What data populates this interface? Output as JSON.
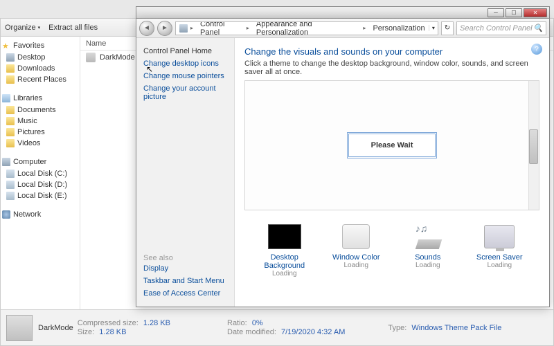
{
  "explorer": {
    "toolbar": {
      "organize": "Organize",
      "extract": "Extract all files"
    },
    "nav": {
      "favorites_header": "Favorites",
      "favorites": [
        "Desktop",
        "Downloads",
        "Recent Places"
      ],
      "libraries_header": "Libraries",
      "libraries": [
        "Documents",
        "Music",
        "Pictures",
        "Videos"
      ],
      "computer_header": "Computer",
      "drives": [
        "Local Disk (C:)",
        "Local Disk (D:)",
        "Local Disk (E:)"
      ],
      "network_header": "Network"
    },
    "columns": {
      "name": "Name"
    },
    "files": [
      {
        "name": "DarkMode"
      }
    ],
    "status": {
      "filename": "DarkMode",
      "compressed_label": "Compressed size:",
      "compressed": "1.28 KB",
      "size_label": "Size:",
      "size": "1.28 KB",
      "ratio_label": "Ratio:",
      "ratio": "0%",
      "modified_label": "Date modified:",
      "modified": "7/19/2020 4:32 AM",
      "type_label": "Type:",
      "type": "Windows Theme Pack File"
    }
  },
  "cp": {
    "breadcrumb": [
      "Control Panel",
      "Appearance and Personalization",
      "Personalization"
    ],
    "search_placeholder": "Search Control Panel",
    "left": {
      "home": "Control Panel Home",
      "links": [
        "Change desktop icons",
        "Change mouse pointers",
        "Change your account picture"
      ],
      "see_also_label": "See also",
      "see_also": [
        "Display",
        "Taskbar and Start Menu",
        "Ease of Access Center"
      ]
    },
    "main": {
      "heading": "Change the visuals and sounds on your computer",
      "subtext": "Click a theme to change the desktop background, window color, sounds, and screen saver all at once.",
      "wait": "Please Wait",
      "tiles": [
        {
          "label": "Desktop Background",
          "status": "Loading"
        },
        {
          "label": "Window Color",
          "status": "Loading"
        },
        {
          "label": "Sounds",
          "status": "Loading"
        },
        {
          "label": "Screen Saver",
          "status": "Loading"
        }
      ]
    }
  }
}
